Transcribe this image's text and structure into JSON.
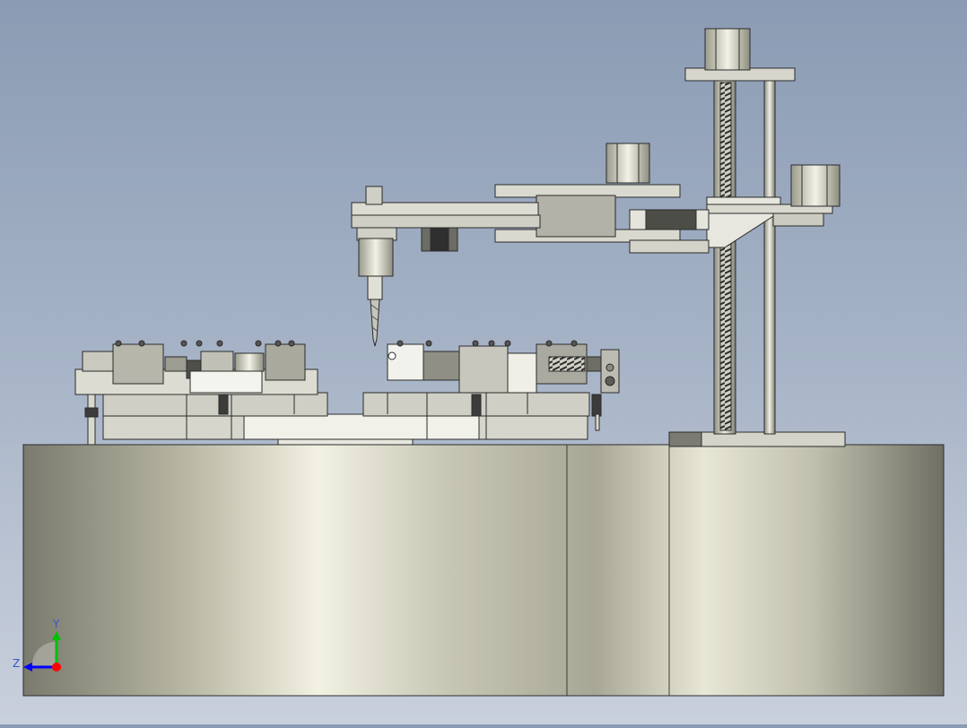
{
  "viewport": {
    "background_top": "#8a9bb3",
    "background_bottom": "#c9d0dc"
  },
  "model": {
    "description_elements": [
      "base-block",
      "rotary-fixture-table",
      "drill-spindle",
      "scara-arm",
      "vertical-ballscrew-column",
      "stepper-motors"
    ]
  },
  "triad": {
    "y_label": "Y",
    "z_label": "Z",
    "colors": {
      "y": "#00c000",
      "z": "#0000ff",
      "x": "#ff0000"
    }
  }
}
